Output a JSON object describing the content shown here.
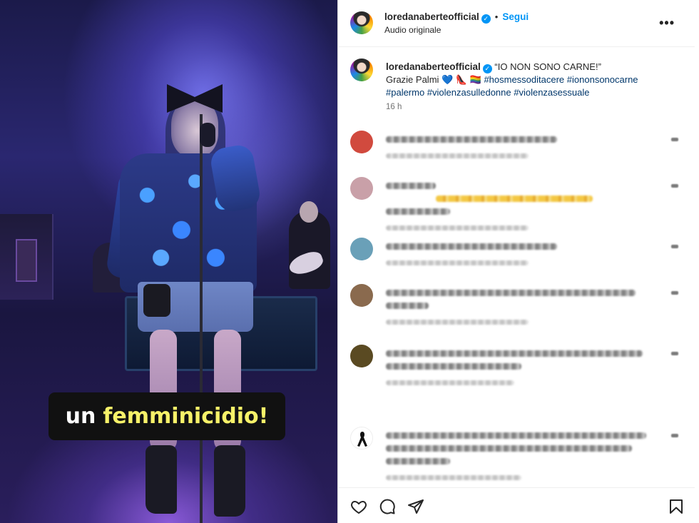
{
  "media": {
    "caption_word1": "un",
    "caption_word2": "femminicidio!",
    "caption_highlight_color": "#f7f269"
  },
  "post_header": {
    "username": "loredanaberteofficial",
    "verified_icon": "verified-badge-icon",
    "separator": "•",
    "follow_label": "Segui",
    "audio_label": "Audio originale",
    "more_label": "•••"
  },
  "post_caption": {
    "username": "loredanaberteofficial",
    "quote": " “IO NON SONO CARNE!”",
    "line2_prefix": "Grazie Palmi ",
    "line2_emojis": "💙 👠 🏳️‍🌈 ",
    "tags_line1": "#hosmessoditacere #iononsonocarne",
    "tags_line2": "#palermo #violenzasulledonne #violenzasessuale",
    "time": "16 h"
  },
  "comments": [
    {
      "avatar": "#d14a3e",
      "lines": [
        {
          "w": 240
        }
      ],
      "meta_w": 200
    },
    {
      "avatar": "#c9a0a8",
      "lines": [
        {
          "w": 70
        },
        {
          "w": 220,
          "emoji": true
        },
        {
          "w": 90
        }
      ],
      "meta_w": 200
    },
    {
      "avatar": "#6aa0b8",
      "lines": [
        {
          "w": 240
        }
      ],
      "meta_w": 200
    },
    {
      "avatar": "#8a6a4e",
      "lines": [
        {
          "w": 350
        },
        {
          "w": 60
        }
      ],
      "meta_w": 200
    },
    {
      "avatar": "#5a4a22",
      "lines": [
        {
          "w": 360
        },
        {
          "w": 190
        }
      ],
      "meta_w": 180
    },
    {
      "avatar": "#ffffff",
      "lines": [
        {
          "w": 365
        },
        {
          "w": 345
        },
        {
          "w": 90
        }
      ],
      "meta_w": 190
    }
  ],
  "actions": {
    "like_icon": "heart-icon",
    "comment_icon": "comment-icon",
    "share_icon": "share-icon",
    "save_icon": "bookmark-icon"
  }
}
